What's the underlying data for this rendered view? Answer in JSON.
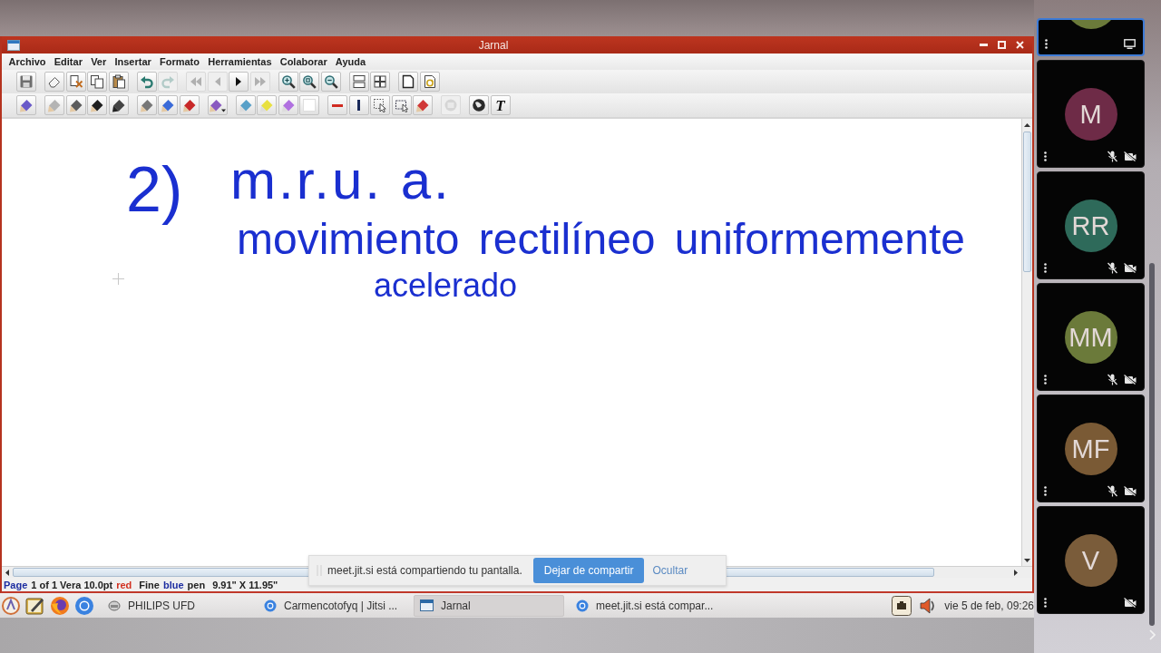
{
  "window": {
    "title": "Jarnal"
  },
  "menu": [
    "Archivo",
    "Editar",
    "Ver",
    "Insertar",
    "Formato",
    "Herramientas",
    "Colaborar",
    "Ayuda"
  ],
  "toolbar_rows": [
    [
      [
        {
          "kind": "save",
          "disabled": false
        }
      ],
      [
        {
          "kind": "eraser",
          "disabled": false
        },
        {
          "kind": "cut",
          "disabled": false
        },
        {
          "kind": "copy",
          "disabled": false
        },
        {
          "kind": "paste",
          "disabled": false
        }
      ],
      [
        {
          "kind": "undo",
          "disabled": false
        },
        {
          "kind": "redo",
          "disabled": true
        }
      ],
      [
        {
          "kind": "first",
          "disabled": true
        },
        {
          "kind": "prev",
          "disabled": true
        },
        {
          "kind": "next",
          "disabled": false
        },
        {
          "kind": "last",
          "disabled": true
        }
      ],
      [
        {
          "kind": "zoom-in",
          "disabled": false
        },
        {
          "kind": "zoom-fit",
          "disabled": false
        },
        {
          "kind": "zoom-out",
          "disabled": false
        }
      ],
      [
        {
          "kind": "layout",
          "disabled": false
        },
        {
          "kind": "grid",
          "disabled": false
        }
      ],
      [
        {
          "kind": "page",
          "disabled": false
        },
        {
          "kind": "page-refresh",
          "disabled": false
        }
      ]
    ],
    [
      [
        {
          "kind": "pen",
          "color": "#6a5ac8",
          "disabled": false
        }
      ],
      [
        {
          "kind": "pen",
          "color": "#b4b4b4",
          "disabled": false
        },
        {
          "kind": "pen",
          "color": "#5c5c5c",
          "disabled": false
        },
        {
          "kind": "pen",
          "color": "#1e1e1e",
          "disabled": false
        },
        {
          "kind": "marker",
          "color": "#444444",
          "disabled": false
        }
      ],
      [
        {
          "kind": "pen",
          "color": "#777777",
          "disabled": false
        },
        {
          "kind": "pen",
          "color": "#3a6ad8",
          "disabled": false
        },
        {
          "kind": "pen",
          "color": "#c82828",
          "disabled": false
        }
      ],
      [
        {
          "kind": "pen-menu",
          "color": "#8a5ac0",
          "disabled": false
        }
      ],
      [
        {
          "kind": "highlighter",
          "color": "#58a0c8",
          "disabled": false
        },
        {
          "kind": "highlighter",
          "color": "#e8e040",
          "disabled": false
        },
        {
          "kind": "highlighter",
          "color": "#b070e0",
          "disabled": false
        },
        {
          "kind": "blank",
          "disabled": false
        }
      ],
      [
        {
          "kind": "hline",
          "color": "#d02a20",
          "disabled": false
        },
        {
          "kind": "vline",
          "color": "#1a2a5a",
          "disabled": false
        },
        {
          "kind": "select",
          "disabled": false
        },
        {
          "kind": "select-rect",
          "disabled": false
        },
        {
          "kind": "pen",
          "color": "#d03838",
          "disabled": false
        }
      ],
      [
        {
          "kind": "image",
          "disabled": true
        }
      ],
      [
        {
          "kind": "globe",
          "disabled": false
        },
        {
          "kind": "text",
          "label": "T",
          "disabled": false
        }
      ]
    ]
  ],
  "notes": [
    "2)",
    "m.r.u. a.",
    "movimiento rectilíneo uniformemente",
    "acelerado"
  ],
  "status_bar": {
    "segments": [
      {
        "text": "Page",
        "color": "#1c2ca0"
      },
      {
        "text": "1 of 1 Vera 10.0pt",
        "color": "#222222"
      },
      {
        "text": "red",
        "color": "#d23020"
      },
      {
        "text": "Fine",
        "color": "#222222"
      },
      {
        "text": "blue",
        "color": "#1c2ca0"
      },
      {
        "text": "pen",
        "color": "#222222"
      },
      {
        "text": "9.91\" X 11.95\"",
        "color": "#222222"
      }
    ]
  },
  "share_notice": {
    "message": "meet.jit.si está compartiendo tu pantalla.",
    "stop_button": "Dejar de compartir",
    "hide_link": "Ocultar"
  },
  "taskbar": {
    "launchers": [
      {
        "kind": "menu"
      },
      {
        "kind": "notes"
      },
      {
        "kind": "fox"
      },
      {
        "kind": "chrome"
      }
    ],
    "tasks": [
      {
        "label": "PHILIPS UFD",
        "kind": "drive",
        "selected": false
      },
      {
        "label": "Carmencotofyq | Jitsi ...",
        "kind": "browser",
        "selected": false
      },
      {
        "label": "Jarnal",
        "kind": "jarnal",
        "selected": true
      },
      {
        "label": "meet.jit.si está compar...",
        "kind": "browser",
        "selected": false
      }
    ],
    "clock": "vie 5 de feb, 09:26"
  },
  "participants": [
    {
      "color": "#6b7a3a",
      "selected": true,
      "mic_muted": false,
      "camera_off": false,
      "screen_sharing": true
    },
    {
      "initials": "M",
      "color": "#6e2b47",
      "selected": false,
      "mic_muted": true,
      "camera_off": true,
      "screen_sharing": false
    },
    {
      "initials": "RR",
      "color": "#2e6a5a",
      "selected": false,
      "mic_muted": true,
      "camera_off": true,
      "screen_sharing": false
    },
    {
      "initials": "MM",
      "color": "#6b7a3a",
      "selected": false,
      "mic_muted": true,
      "camera_off": true,
      "screen_sharing": false
    },
    {
      "initials": "MF",
      "color": "#7a5a35",
      "selected": false,
      "mic_muted": true,
      "camera_off": true,
      "screen_sharing": false
    },
    {
      "initials": "V",
      "color": "#7a5c3a",
      "selected": false,
      "mic_muted": false,
      "camera_off": true,
      "screen_sharing": false
    }
  ]
}
